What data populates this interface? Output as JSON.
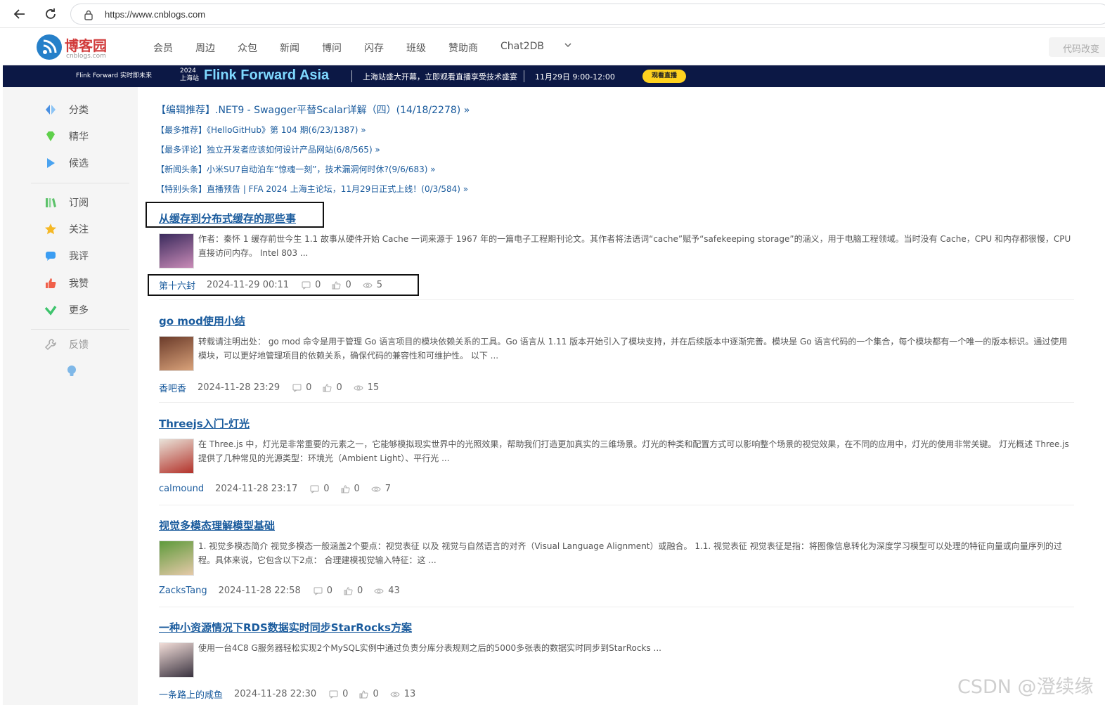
{
  "browser": {
    "url": "https://www.cnblogs.com",
    "icons": {
      "back": "back-arrow-icon",
      "reload": "reload-icon",
      "lock": "lock-icon"
    }
  },
  "header": {
    "logo_name": "博客园",
    "logo_domain": "cnblogs.com",
    "nav": [
      "会员",
      "周边",
      "众包",
      "新闻",
      "博问",
      "闪存",
      "班级",
      "赞助商",
      "Chat2DB"
    ],
    "search_placeholder": "代码改变"
  },
  "banner": {
    "logo_text": "Flink Forward 实时即未来",
    "year_text": "2024 上海站",
    "title": "Flink Forward Asia",
    "desc": "上海站盛大开幕，立即观看直播享受技术盛宴",
    "time": "11月29日 9:00-12:00",
    "button": "观看直播"
  },
  "sidebar": {
    "group1": [
      {
        "label": "分类",
        "icon": "category-icon",
        "color": "#4a90e2"
      },
      {
        "label": "精华",
        "icon": "gem-icon",
        "color": "#5fd04b"
      },
      {
        "label": "候选",
        "icon": "play-icon",
        "color": "#4aa3f0"
      }
    ],
    "group2": [
      {
        "label": "订阅",
        "icon": "books-icon",
        "color": "#5cc26a"
      },
      {
        "label": "关注",
        "icon": "star-icon",
        "color": "#f5b825"
      },
      {
        "label": "我评",
        "icon": "comment-icon",
        "color": "#3b9df2"
      },
      {
        "label": "我赞",
        "icon": "thumbs-up-icon",
        "color": "#f0604a"
      },
      {
        "label": "更多",
        "icon": "check-icon",
        "color": "#3ec46d"
      }
    ],
    "feedback": {
      "label": "反馈",
      "icon": "wrench-icon"
    },
    "tip_icon": "lightbulb-icon"
  },
  "recommendations": [
    "【编辑推荐】.NET9 - Swagger平替Scalar详解（四）(14/18/2278) »",
    "【最多推荐】《HelloGitHub》第 104 期(6/23/1387) »",
    "【最多评论】独立开发者应该如何设计产品网站(6/8/565) »",
    "【新闻头条】小米SU7自动泊车“惊魂一刻”，技术漏洞何时休?(9/6/683) »",
    "【特别头条】直播预告 | FFA 2024 上海主论坛，11月29日正式上线！(0/3/584) »"
  ],
  "posts": [
    {
      "title": "从缓存到分布式缓存的那些事",
      "summary": "作者：秦怀 1 缓存前世今生 1.1 故事从硬件开始 Cache 一词来源于 1967 年的一篇电子工程期刊论文。其作者将法语词“cache”赋予“safekeeping storage”的涵义，用于电脑工程领域。当时没有 Cache，CPU 和内存都很慢，CPU 直接访问内存。 Intel 803 ...",
      "author": "第十六封",
      "date": "2024-11-29 00:11",
      "comments": "0",
      "likes": "0",
      "views": "5",
      "thumb_colors": [
        "#3a2a5c",
        "#c98bb7"
      ]
    },
    {
      "title": "go mod使用小结",
      "summary": "转载请注明出处： go mod 命令是用于管理 Go 语言项目的模块依赖关系的工具。Go 语言从 1.11 版本开始引入了模块支持，并在后续版本中逐渐完善。模块是 Go 语言代码的一个集合，每个模块都有一个唯一的版本标识。通过使用模块，可以更好地管理项目的依赖关系，确保代码的兼容性和可维护性。 以下 ...",
      "author": "香吧香",
      "date": "2024-11-28 23:29",
      "comments": "0",
      "likes": "0",
      "views": "15",
      "thumb_colors": [
        "#6b3b2a",
        "#d9a27a"
      ]
    },
    {
      "title": "Threejs入门-灯光",
      "summary": "在 Three.js 中，灯光是非常重要的元素之一，它能够模拟现实世界中的光照效果，帮助我们打造更加真实的三维场景。灯光的种类和配置方式可以影响整个场景的视觉效果，在不同的应用中，灯光的使用非常关键。 灯光概述 Three.js 提供了几种常见的光源类型：环境光（Ambient Light）、平行光 ...",
      "author": "calmound",
      "date": "2024-11-28 23:17",
      "comments": "0",
      "likes": "0",
      "views": "7",
      "thumb_colors": [
        "#e9e2d8",
        "#b3322a"
      ]
    },
    {
      "title": "视觉多模态理解模型基础",
      "summary": "1. 视觉多模态简介 视觉多模态一般涵盖2个要点：视觉表征 以及 视觉与自然语言的对齐（Visual Language Alignment）或融合。 1.1. 视觉表征 视觉表征是指：将图像信息转化为深度学习模型可以处理的特征向量或向量序列的过程。具体来说，它包含以下2点： 合理建模视觉输入特征：这 ...",
      "author": "ZacksTang",
      "date": "2024-11-28 22:58",
      "comments": "0",
      "likes": "0",
      "views": "43",
      "thumb_colors": [
        "#5e9a3b",
        "#e5c9a8"
      ]
    },
    {
      "title": "一种小资源情况下RDS数据实时同步StarRocks方案",
      "summary": "使用一台4C8 G服务器轻松实现2个MySQL实例中通过负责分库分表规则之后的5000多张表的数据实时同步到StarRocks ...",
      "author": "一条路上的咸鱼",
      "date": "2024-11-28 22:30",
      "comments": "0",
      "likes": "0",
      "views": "13",
      "thumb_colors": [
        "#f2ddd8",
        "#3a3340"
      ]
    }
  ],
  "watermark": "CSDN @澄续缘",
  "colors": {
    "link": "#1a5b9d",
    "banner_bg": "#0c1845",
    "sidebar_bg": "#f5f5f5"
  }
}
